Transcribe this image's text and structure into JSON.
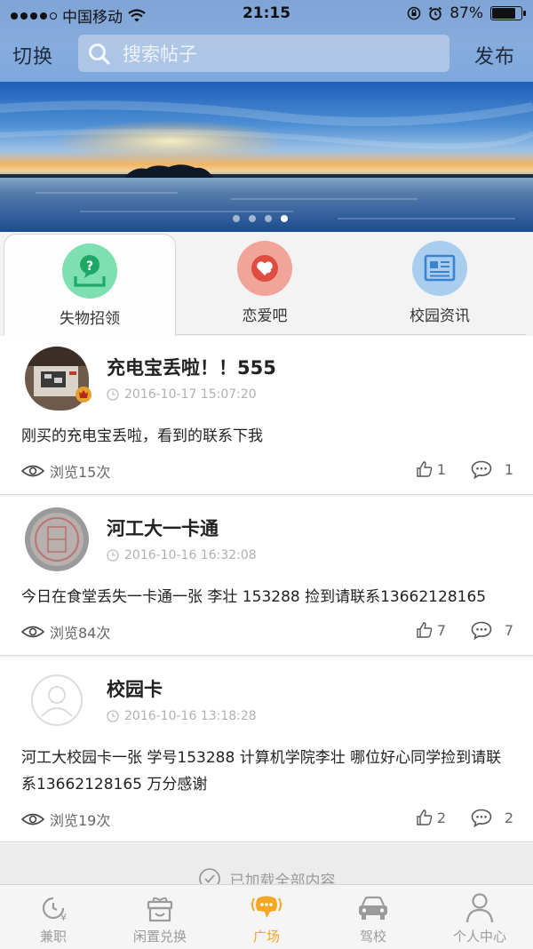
{
  "status": {
    "carrier": "中国移动",
    "time": "21:15",
    "battery": "87%",
    "battery_level": 0.87
  },
  "nav": {
    "left_label": "切换",
    "search_placeholder": "搜索帖子",
    "right_label": "发布"
  },
  "banner": {
    "page_count": 4,
    "active_page": 4
  },
  "categories": [
    {
      "label": "失物招领",
      "icon": "lost-found-icon",
      "color": "#7ee0b0",
      "active": true
    },
    {
      "label": "恋爱吧",
      "icon": "heart-icon",
      "color": "#f0a49a",
      "active": false
    },
    {
      "label": "校园资讯",
      "icon": "news-icon",
      "color": "#a9cdee",
      "active": false
    }
  ],
  "posts": [
    {
      "title": "充电宝丢啦！！555",
      "time": "2016-10-17 15:07:20",
      "body": "刚买的充电宝丢啦，看到的联系下我",
      "views": "浏览15次",
      "likes": "1",
      "comments": "1"
    },
    {
      "title": "河工大一卡通",
      "time": "2016-10-16 16:32:08",
      "body": "今日在食堂丢失一卡通一张 李壮 153288 捡到请联系13662128165",
      "views": "浏览84次",
      "likes": "7",
      "comments": "7"
    },
    {
      "title": "校园卡",
      "time": "2016-10-16 13:18:28",
      "body": "河工大校园卡一张 学号153288 计算机学院李壮 哪位好心同学捡到请联系13662128165 万分感谢",
      "views": "浏览19次",
      "likes": "2",
      "comments": "2"
    }
  ],
  "footer": {
    "loaded_text": "已加载全部内容"
  },
  "tabbar": [
    {
      "label": "兼职",
      "icon": "clock-yen-icon",
      "active": false
    },
    {
      "label": "闲置兑换",
      "icon": "gift-box-icon",
      "active": false
    },
    {
      "label": "广场",
      "icon": "broadcast-icon",
      "active": true
    },
    {
      "label": "驾校",
      "icon": "car-icon",
      "active": false
    },
    {
      "label": "个人中心",
      "icon": "person-icon",
      "active": false
    }
  ],
  "colors": {
    "accent": "#f5a623",
    "header": "#86acdd"
  }
}
